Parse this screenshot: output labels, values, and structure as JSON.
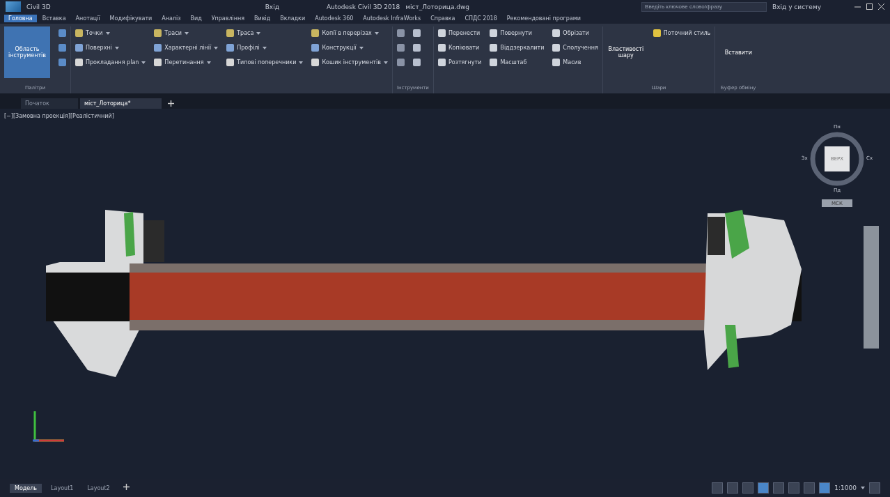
{
  "title_bar": {
    "quick_access": "Civil 3D",
    "workspace": "Вхід",
    "app_title": "Autodesk Civil 3D 2018",
    "file_name": "міст_Лоторица.dwg",
    "search": {
      "placeholder": "Введіть ключове слово/фразу"
    },
    "user": "Вхід у систему"
  },
  "menu_tabs": [
    {
      "label": "Головна",
      "selected": true
    },
    {
      "label": "Вставка",
      "selected": false
    },
    {
      "label": "Анотації",
      "selected": false
    },
    {
      "label": "Модифікувати",
      "selected": false
    },
    {
      "label": "Аналіз",
      "selected": false
    },
    {
      "label": "Вид",
      "selected": false
    },
    {
      "label": "Управління",
      "selected": false
    },
    {
      "label": "Вивід",
      "selected": false
    },
    {
      "label": "Вкладки",
      "selected": false
    },
    {
      "label": "Autodesk 360",
      "selected": false
    },
    {
      "label": "Autodesk InfraWorks",
      "selected": false
    },
    {
      "label": "Справка",
      "selected": false
    },
    {
      "label": "СПДС 2018",
      "selected": false
    },
    {
      "label": "Рекомендовані програми",
      "selected": false
    }
  ],
  "ribbon": {
    "big_button": {
      "label": "Область інструментів",
      "selected": true
    },
    "palettes_label": "Палітри",
    "columns": [
      {
        "items": [
          {
            "label": "Точки"
          },
          {
            "label": "Поверхні"
          },
          {
            "label": "Прокладання plan"
          }
        ]
      },
      {
        "items": [
          {
            "label": "Траси"
          },
          {
            "label": "Характерні лінії"
          },
          {
            "label": "Перетинання"
          }
        ]
      },
      {
        "items": [
          {
            "label": "Траса"
          },
          {
            "label": "Профілі"
          },
          {
            "label": "Типові поперечники"
          }
        ]
      },
      {
        "items": [
          {
            "label": "Копії в перерізах"
          },
          {
            "label": "Конструкції"
          },
          {
            "label": "Кошик інструментів"
          }
        ]
      }
    ],
    "draw_label": "Інструменти",
    "modify_columns": [
      {
        "items": [
          {
            "label": "Перенести"
          },
          {
            "label": "Копіювати"
          },
          {
            "label": "Розтягнути"
          }
        ]
      },
      {
        "items": [
          {
            "label": "Повернути"
          },
          {
            "label": "Віддзеркалити"
          },
          {
            "label": "Масштаб"
          }
        ]
      },
      {
        "items": [
          {
            "label": "Обрізати"
          },
          {
            "label": "Сполучення"
          },
          {
            "label": "Масив"
          }
        ]
      }
    ],
    "layer_button": "Властивості шару",
    "layer_style": "Поточний стиль",
    "layers_label": "Шари",
    "paste_button": "Вставити",
    "clipboard_label": "Буфер обміну"
  },
  "doc_tabs": [
    {
      "label": "Початок",
      "selected": false
    },
    {
      "label": "міст_Лоторица*",
      "selected": true
    }
  ],
  "viewport": {
    "label": "[−][Замовна проекція][Реалістичний]",
    "viewcube": {
      "face": "ВЕРХ",
      "north": "Пн",
      "south": "Пд",
      "east": "Сх",
      "west": "Зх",
      "ucs": "МСК"
    }
  },
  "layout_tabs": [
    {
      "label": "Модель",
      "selected": true
    },
    {
      "label": "Layout1",
      "selected": false
    },
    {
      "label": "Layout2",
      "selected": false
    }
  ],
  "status_bar": {
    "scale": "1:1000",
    "tools": [
      {
        "on": false
      },
      {
        "on": false
      },
      {
        "on": false
      },
      {
        "on": true
      },
      {
        "on": false
      },
      {
        "on": false
      },
      {
        "on": false
      },
      {
        "on": true
      },
      {
        "on": false
      }
    ]
  }
}
